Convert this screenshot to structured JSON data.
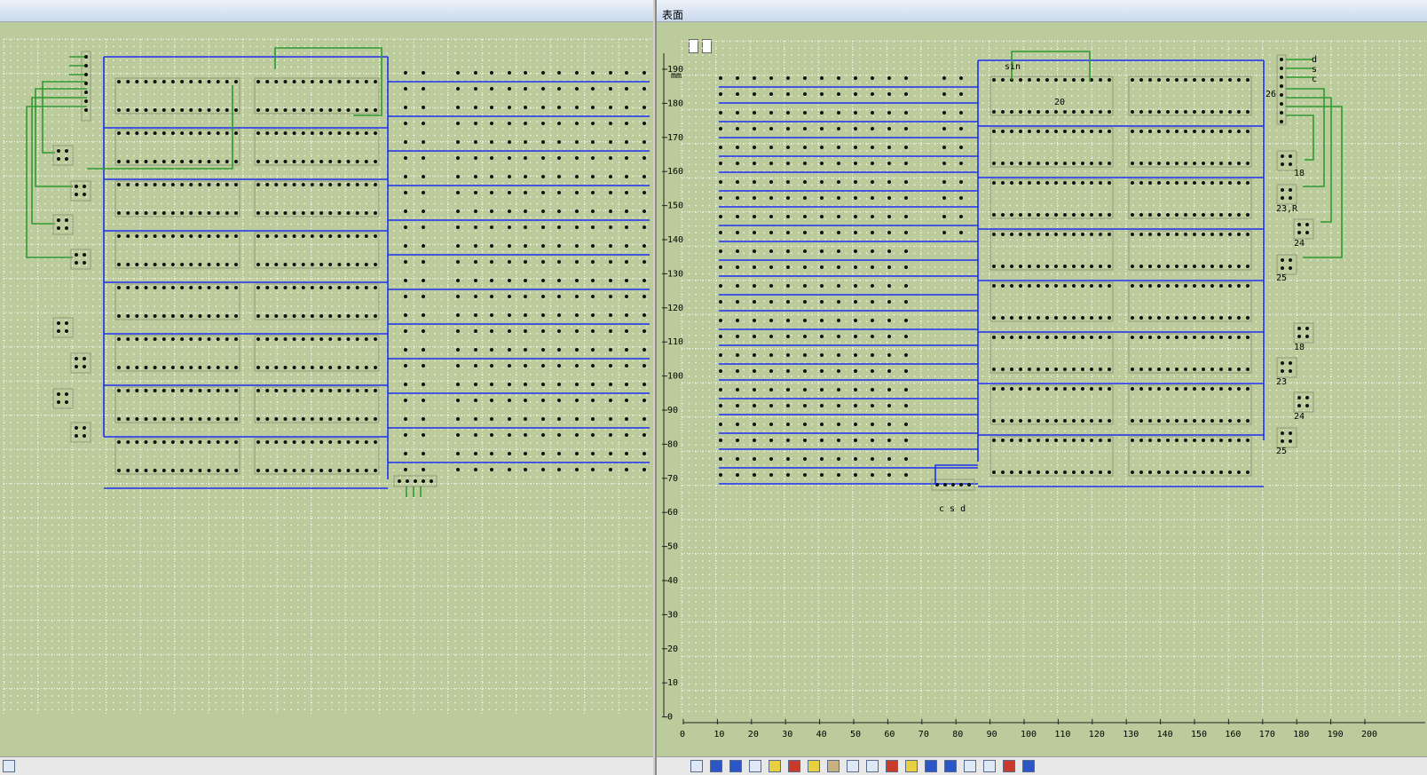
{
  "right_window": {
    "title": "表面",
    "y_axis_unit": "mm",
    "y_ticks": [
      "190",
      "180",
      "170",
      "160",
      "150",
      "140",
      "130",
      "120",
      "110",
      "100",
      "90",
      "80",
      "70",
      "60",
      "50",
      "40",
      "30",
      "20",
      "10",
      "0"
    ],
    "x_ticks": [
      "0",
      "10",
      "20",
      "30",
      "40",
      "50",
      "60",
      "70",
      "80",
      "90",
      "100",
      "110",
      "120",
      "130",
      "140",
      "150",
      "160",
      "170",
      "180",
      "190",
      "200"
    ],
    "labels": {
      "sin": "sin",
      "twenty": "20",
      "d": "d",
      "s": "s",
      "c": "c",
      "twentysix": "26",
      "l18a": "18",
      "l23r": "23,R",
      "l24a": "24",
      "l25a": "25",
      "l18b": "18",
      "l23b": "23",
      "l24b": "24",
      "l25b": "25",
      "csd": "c s d"
    }
  },
  "colors": {
    "board_background": "#bccb9c",
    "blue_wire": "#1c2ff0",
    "green_wire": "#2f9a2f",
    "pad": "#111111"
  },
  "icons": {
    "left_status": "app-icon",
    "toolbar": [
      "arrow-down-icon",
      "arrow-up-icon",
      "tool-icon",
      "tool-icon",
      "tool-icon",
      "tool-icon",
      "tool-icon",
      "tool-icon",
      "tool-icon",
      "tool-icon",
      "tool-icon",
      "tool-icon",
      "tool-icon",
      "tool-icon",
      "tool-icon",
      "tool-icon",
      "pencil-icon",
      "help-icon"
    ]
  }
}
